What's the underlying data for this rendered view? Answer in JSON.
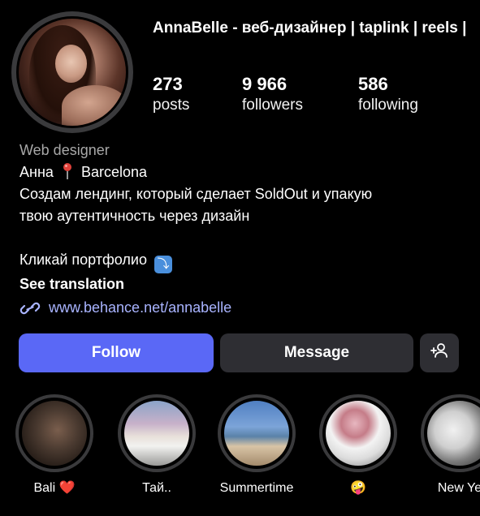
{
  "profile": {
    "display_name": "AnnaBelle - веб-дизайнер | taplink | reels |"
  },
  "stats": {
    "posts": {
      "value": "273",
      "label": "posts"
    },
    "followers": {
      "value": "9 966",
      "label": "followers"
    },
    "following": {
      "value": "586",
      "label": "following"
    }
  },
  "bio": {
    "category": "Web designer",
    "name": "Анна",
    "pin_emoji": "📍",
    "location": "Barcelona",
    "line_1": "Создам лендинг, который сделает SoldOut и упакую",
    "line_2": "твою аутентичность через дизайн",
    "portfolio_text": "Кликай портфолио",
    "portfolio_emoji": "⤵",
    "see_translation": "See translation",
    "link": "www.behance.net/annabelle"
  },
  "actions": {
    "follow_label": "Follow",
    "message_label": "Message",
    "add_person_icon": "add-person-icon"
  },
  "highlights": [
    {
      "label": "Bali ❤️"
    },
    {
      "label": "Тай.."
    },
    {
      "label": "Summertime"
    },
    {
      "label": "🤪"
    },
    {
      "label": "New Ye"
    }
  ],
  "colors": {
    "background": "#000000",
    "follow_button": "#5a68f6",
    "secondary_button": "#2e2e33",
    "link": "#a9b4ff",
    "category_text": "#a8a8a8"
  }
}
